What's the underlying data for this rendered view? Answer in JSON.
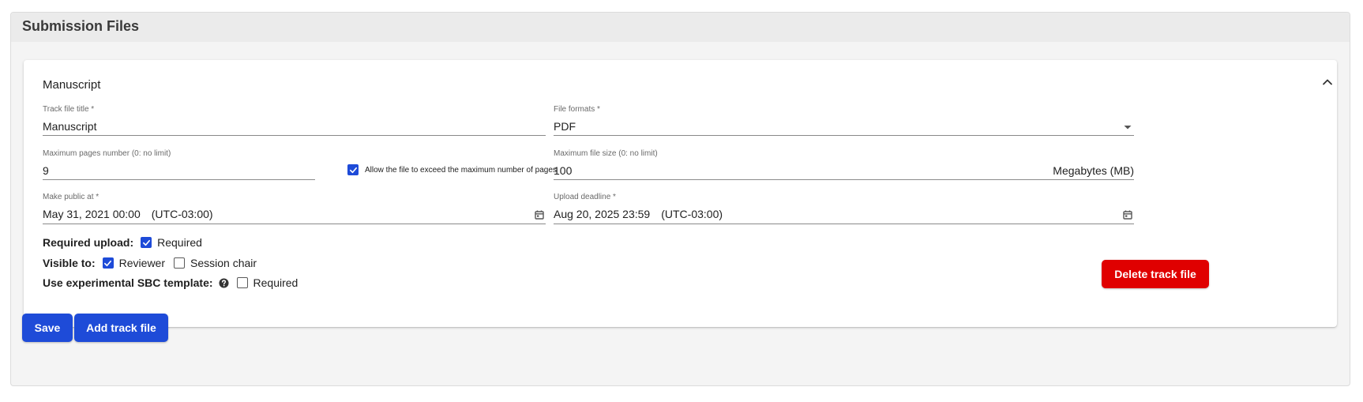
{
  "panel": {
    "title": "Submission Files"
  },
  "card": {
    "title": "Manuscript",
    "track_file_title": {
      "label": "Track file title *",
      "value": "Manuscript"
    },
    "file_formats": {
      "label": "File formats *",
      "value": "PDF"
    },
    "max_pages": {
      "label": "Maximum pages number (0: no limit)",
      "value": "9"
    },
    "allow_exceed": {
      "label": "Allow the file to exceed the maximum number of pages",
      "checked": true
    },
    "max_file_size": {
      "label": "Maximum file size (0: no limit)",
      "value": "100",
      "unit": "Megabytes (MB)"
    },
    "make_public": {
      "label": "Make public at *",
      "date": "May 31, 2021 00:00",
      "timezone": "(UTC-03:00)"
    },
    "upload_deadline": {
      "label": "Upload deadline *",
      "date": "Aug 20, 2025 23:59",
      "timezone": "(UTC-03:00)"
    },
    "required_upload": {
      "label": "Required upload:",
      "option": "Required",
      "checked": true
    },
    "visible_to": {
      "label": "Visible to:",
      "options": [
        {
          "label": "Reviewer",
          "checked": true
        },
        {
          "label": "Session chair",
          "checked": false
        }
      ]
    },
    "experimental": {
      "label": "Use experimental SBC template:",
      "option": "Required",
      "checked": false
    },
    "delete_label": "Delete track file"
  },
  "actions": {
    "save_label": "Save",
    "add_label": "Add track file"
  },
  "icons": {
    "collapse": "chevron-up-icon",
    "dropdown": "caret-down-icon",
    "calendar": "calendar-icon",
    "help": "question-circle-icon",
    "check": "check-icon"
  },
  "colors": {
    "primary": "#1e4bd8",
    "danger": "#e00000"
  }
}
